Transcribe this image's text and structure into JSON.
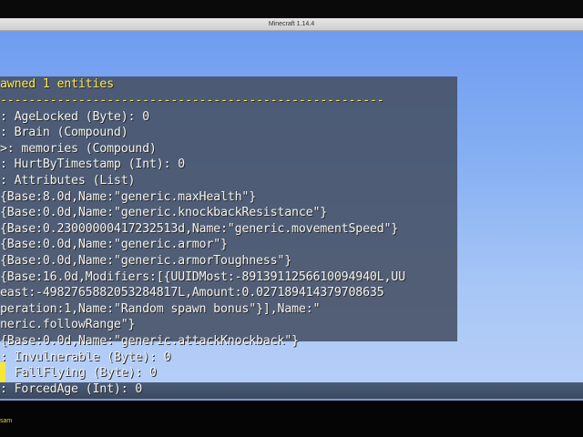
{
  "window": {
    "title": "Minecraft 1.14.4"
  },
  "chat": {
    "lines": [
      {
        "text": "awned 1 entities",
        "class": "c-yellow"
      },
      {
        "text": "------------------------------------------------------",
        "class": "c-dash"
      },
      {
        "text": ": AgeLocked (Byte): 0",
        "class": ""
      },
      {
        "text": ": Brain (Compound)",
        "class": ""
      },
      {
        "text": ">: memories (Compound)",
        "class": ""
      },
      {
        "text": ": HurtByTimestamp (Int): 0",
        "class": ""
      },
      {
        "text": ": Attributes (List)",
        "class": ""
      },
      {
        "text": " {Base:8.0d,Name:\"generic.maxHealth\"}",
        "class": ""
      },
      {
        "text": " {Base:0.0d,Name:\"generic.knockbackResistance\"}",
        "class": ""
      },
      {
        "text": " {Base:0.23000000417232513d,Name:\"generic.movementSpeed\"}",
        "class": ""
      },
      {
        "text": " {Base:0.0d,Name:\"generic.armor\"}",
        "class": ""
      },
      {
        "text": " {Base:0.0d,Name:\"generic.armorToughness\"}",
        "class": ""
      },
      {
        "text": " {Base:16.0d,Modifiers:[{UUIDMost:-8913911256610094940L,UU",
        "class": ""
      },
      {
        "text": "east:-4982765882053284817L,Amount:0.027189414379708635",
        "class": ""
      },
      {
        "text": "peration:1,Name:\"Random spawn bonus\"}],Name:\"",
        "class": ""
      },
      {
        "text": "neric.followRange\"}",
        "class": ""
      },
      {
        "text": " {Base:0.0d,Name:\"generic.attackKnockback\"}",
        "class": ""
      },
      {
        "text": ": Invulnerable (Byte): 0",
        "class": ""
      },
      {
        "text": ": FallFlying (Byte): 0",
        "class": ""
      },
      {
        "text": ": ForcedAge (Int): 0",
        "class": ""
      }
    ]
  },
  "input": {
    "text": "sam"
  },
  "colors": {
    "sky": "#86b0f3",
    "chat_bg": "#465064",
    "highlight": "#ffea4a"
  }
}
